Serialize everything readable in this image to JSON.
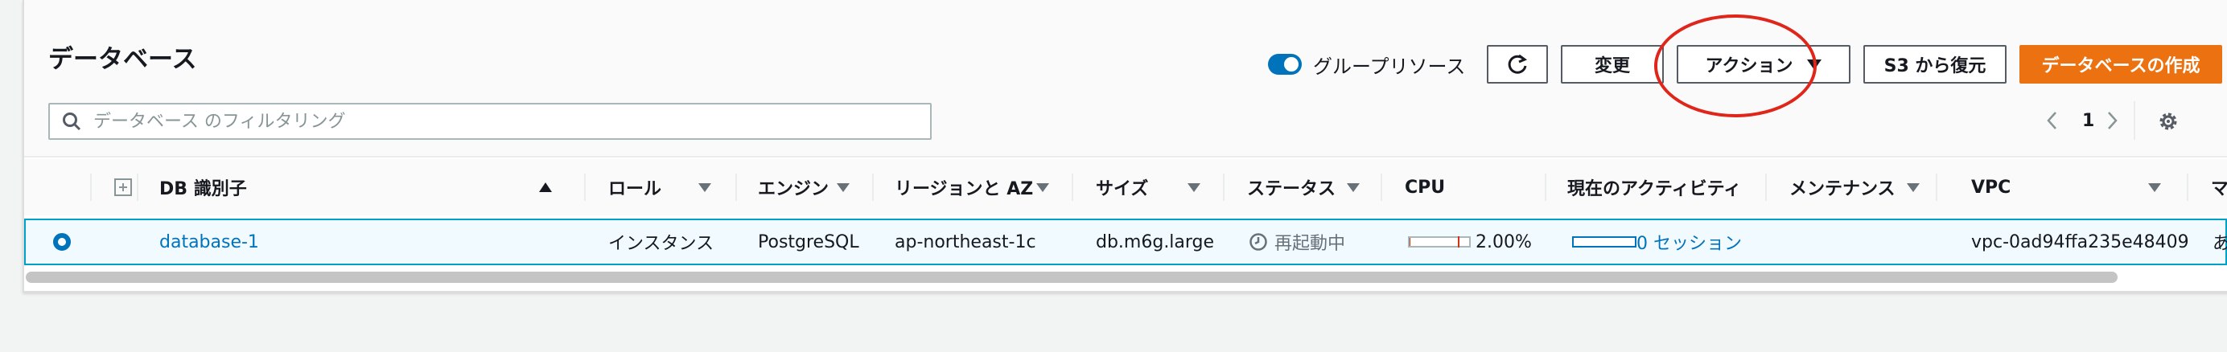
{
  "panel": {
    "title": "データベース",
    "toggle_label": "グループリソース",
    "toggle_on": true
  },
  "toolbar": {
    "modify_label": "変更",
    "action_label": "アクション",
    "restore_label": "S3 から復元",
    "create_label": "データベースの作成"
  },
  "search": {
    "placeholder": "データベース のフィルタリング",
    "value": ""
  },
  "pagination": {
    "current_page": "1"
  },
  "table": {
    "columns": [
      "DB 識別子",
      "ロール",
      "エンジン",
      "リージョンと AZ",
      "サイズ",
      "ステータス",
      "CPU",
      "現在のアクティビティ",
      "メンテナンス",
      "VPC",
      "マ"
    ],
    "rows": [
      {
        "selected": true,
        "db_id": "database-1",
        "role": "インスタンス",
        "engine": "PostgreSQL",
        "region_az": "ap-northeast-1c",
        "size": "db.m6g.large",
        "status": "再起動中",
        "cpu": "2.00%",
        "cpu_fraction": 0.02,
        "activity": "0 セッション",
        "maintenance": "",
        "vpc": "vpc-0ad94ffa235e48409",
        "extra": "あ"
      }
    ]
  },
  "colors": {
    "accent": "#0073bb",
    "primary_button": "#ec7211",
    "selected_row_bg": "#f1faff",
    "selected_row_border": "#00a1c9",
    "annotation": "#e0251b"
  },
  "icons": [
    "search-icon",
    "refresh-icon",
    "caret-down-icon",
    "chevron-left-icon",
    "chevron-right-icon",
    "gear-icon",
    "expand-icon",
    "sort-icon",
    "clock-icon"
  ]
}
